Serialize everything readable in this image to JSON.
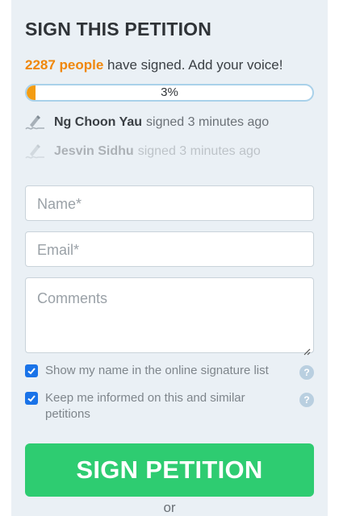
{
  "petition": {
    "title": "SIGN THIS PETITION",
    "count_text": "2287 people",
    "count_suffix": " have signed. Add your voice!",
    "progress_label": "3%",
    "progress_fraction": 0.03
  },
  "recent_signers": [
    {
      "name": "Ng Choon Yau",
      "when": "signed 3 minutes ago"
    },
    {
      "name": "Jesvin Sidhu",
      "when": "signed 3 minutes ago"
    }
  ],
  "form": {
    "name_placeholder": "Name*",
    "email_placeholder": "Email*",
    "comments_placeholder": "Comments",
    "show_name_label": "Show my name in the online signature list",
    "show_name_checked": true,
    "keep_informed_label": "Keep me informed on this and similar petitions",
    "keep_informed_checked": true,
    "help_symbol": "?"
  },
  "actions": {
    "sign_button_label": "SIGN PETITION",
    "or_text": "or"
  },
  "colors": {
    "accent_orange": "#f0870b",
    "button_green": "#2ecc71",
    "checkbox_blue": "#1a73e8",
    "panel_bg": "#eaf0f5"
  },
  "icons": {
    "signer": "signature-pen-icon",
    "help": "question-circle-icon",
    "check": "check-icon"
  }
}
